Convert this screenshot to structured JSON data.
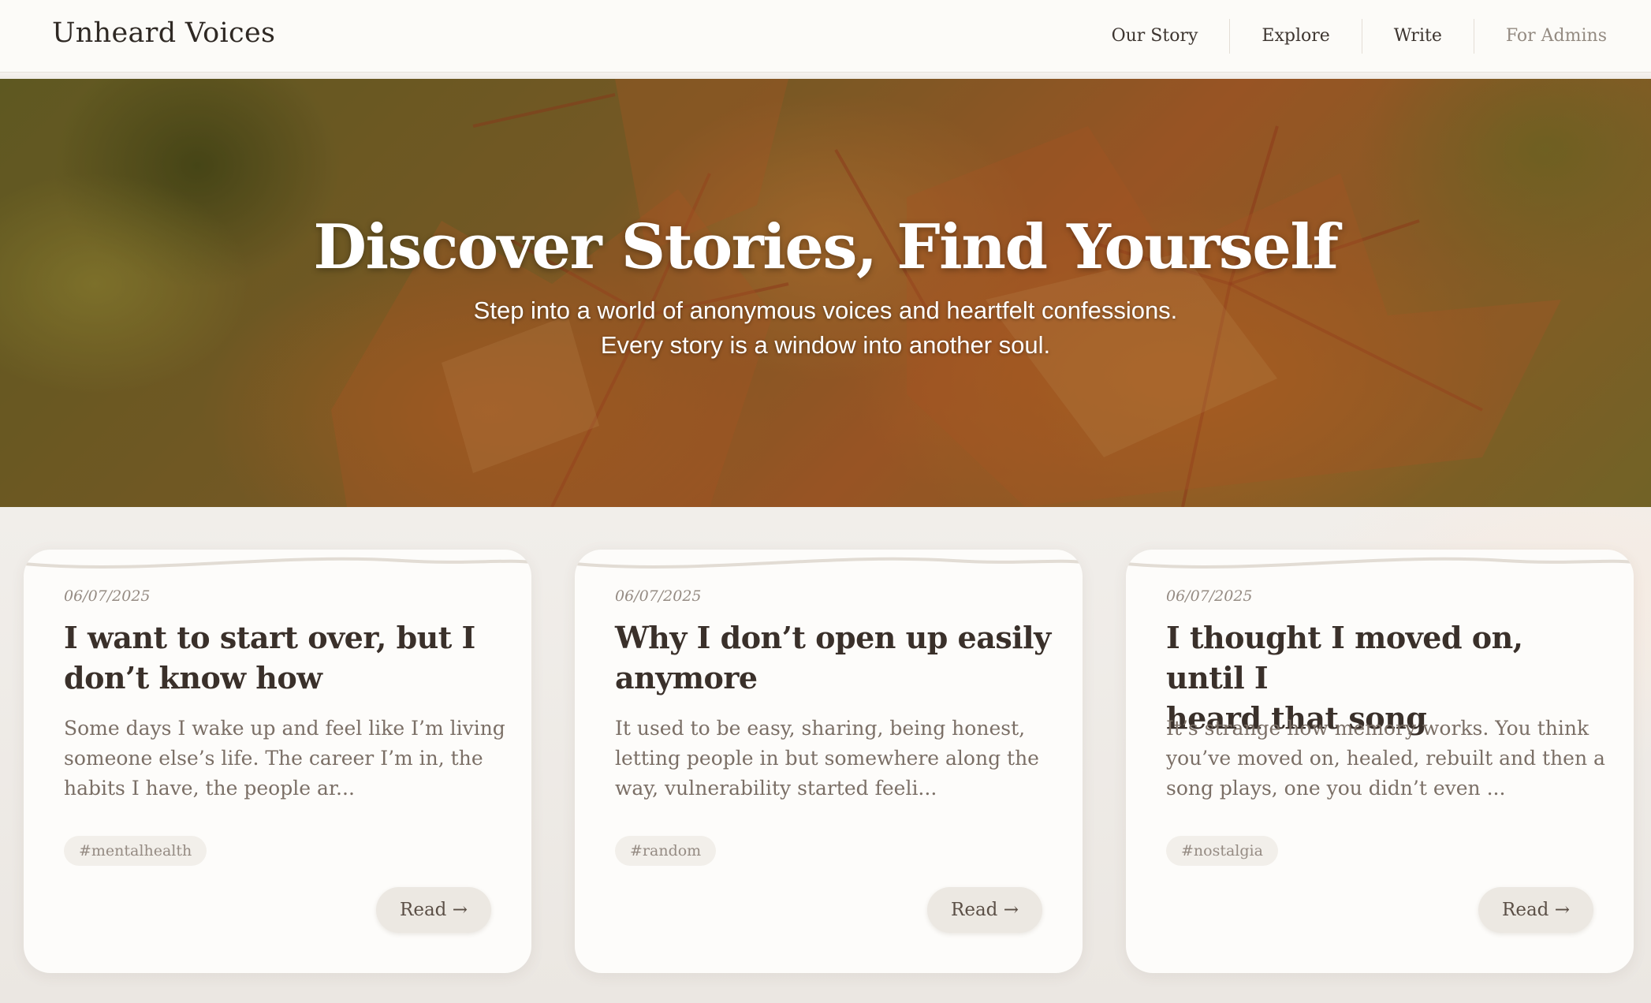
{
  "brand": "Unheard Voices",
  "nav": {
    "items": [
      "Our Story",
      "Explore",
      "Write",
      "For Admins"
    ]
  },
  "hero": {
    "title": "Discover Stories, Find Yourself",
    "subtitle_line1": "Step into a world of anonymous voices and heartfelt confessions.",
    "subtitle_line2": "Every story is a window into another soul."
  },
  "stories": [
    {
      "date": "06/07/2025",
      "title_line1": "I want to start over, but I",
      "title_line2": "don’t know how",
      "excerpt_line1": "Some days I wake up and feel like I’m living",
      "excerpt_line2": "someone else’s life. The career I’m in, the",
      "excerpt_line3": "habits I have, the people ar...",
      "tag": "#mentalhealth",
      "read_label": "Read →"
    },
    {
      "date": "06/07/2025",
      "title_line1": "Why I don’t open up easily",
      "title_line2": "anymore",
      "excerpt_line1": "It used to be easy, sharing, being honest,",
      "excerpt_line2": "letting people in but somewhere along the",
      "excerpt_line3": "way, vulnerability started feeli...",
      "tag": "#random",
      "read_label": "Read →"
    },
    {
      "date": "06/07/2025",
      "title_line1": "I thought I moved on, until I",
      "title_line2": "heard that song",
      "excerpt_line1": "It’s strange how memory works. You think",
      "excerpt_line2": "you’ve moved on, healed, rebuilt and then a",
      "excerpt_line3": "song plays, one you didn’t even ...",
      "tag": "#nostalgia",
      "read_label": "Read →"
    }
  ],
  "colors": {
    "nav_bg": "#fcfbf8",
    "page_bg": "#ece8e2",
    "card_bg": "#fdfcfa",
    "title_text": "#3a302a",
    "muted_text": "#958b83",
    "read_button_bg": "#ece8e2"
  }
}
